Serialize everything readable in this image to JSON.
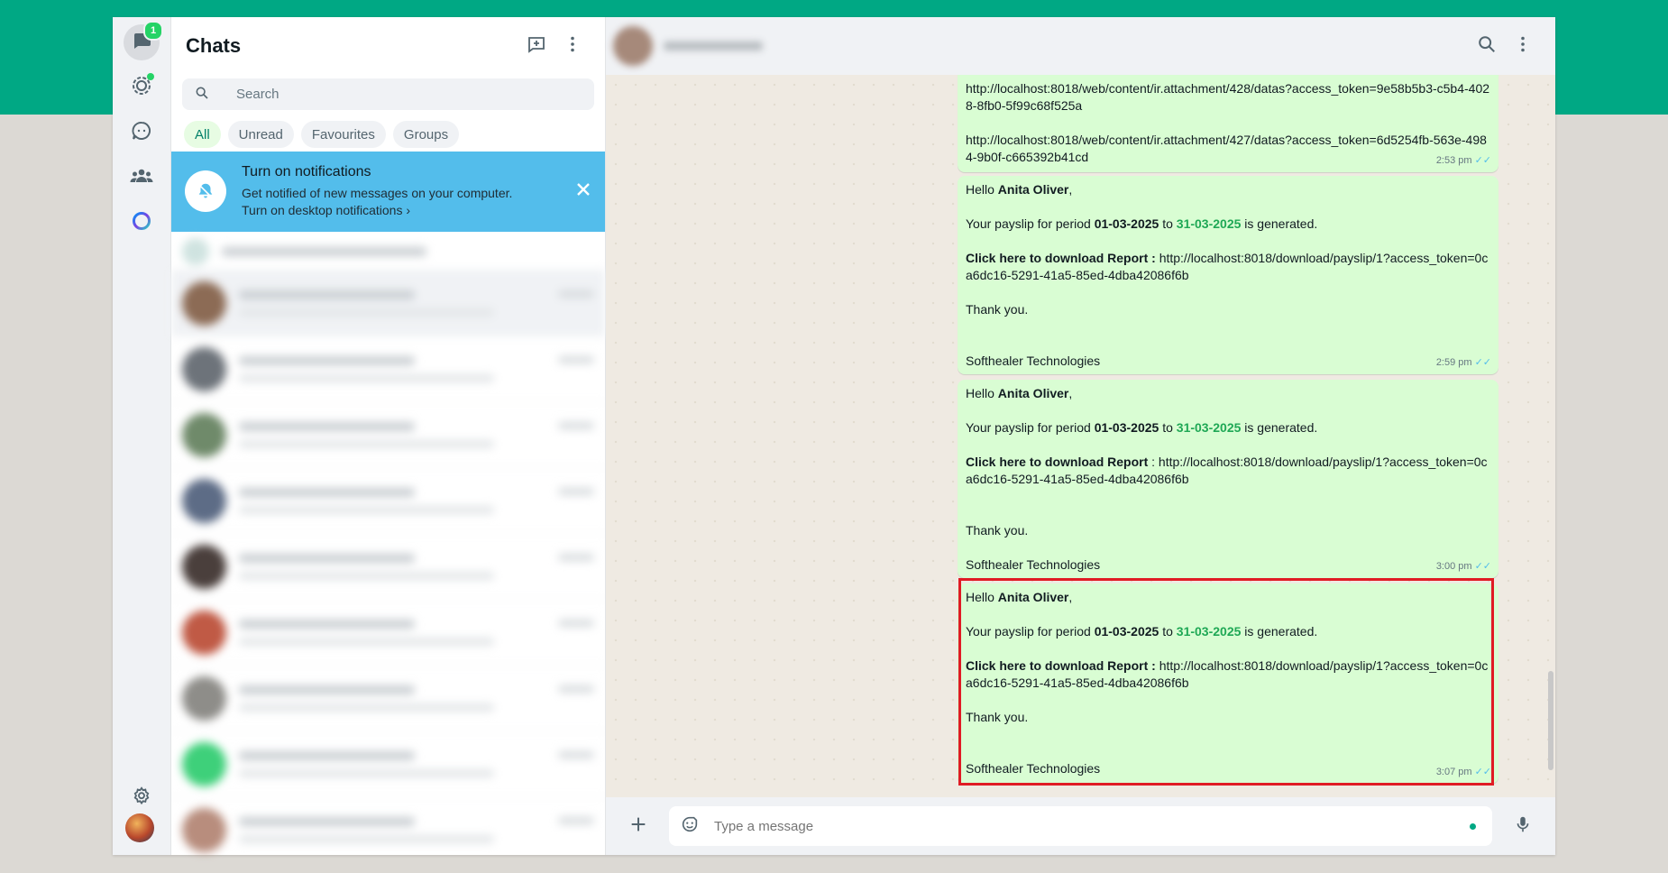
{
  "rail": {
    "chats_badge": "1",
    "icons": [
      "chats-icon",
      "status-icon",
      "channels-icon",
      "communities-icon",
      "meta-ai-icon",
      "settings-icon"
    ]
  },
  "sidebar": {
    "title": "Chats",
    "search_placeholder": "Search",
    "filters": [
      "All",
      "Unread",
      "Favourites",
      "Groups"
    ],
    "notification": {
      "title": "Turn on notifications",
      "subtitle": "Get notified of new messages on your computer.",
      "link": "Turn on desktop notifications"
    }
  },
  "conversation": {
    "messages": [
      {
        "link1": "http://localhost:8018/web/content/ir.attachment/428/datas?access_token=9e58b5b3-c5b4-4028-8fb0-5f99c68f525a",
        "link2": "http://localhost:8018/web/content/ir.attachment/427/datas?access_token=6d5254fb-563e-4984-9b0f-c665392b41cd",
        "time": "2:53 pm"
      },
      {
        "hello": "Hello ",
        "name": "Anita Oliver",
        "comma": ",",
        "payslip_pre": "Your payslip for period ",
        "from": "01-03-2025",
        "to_word": " to ",
        "to": "31-03-2025",
        "payslip_post": " is generated.",
        "download_label": "Click here to download Report : ",
        "download_link": "http://localhost:8018/download/payslip/1?access_token=0ca6dc16-5291-41a5-85ed-4dba42086f6b",
        "thanks": "Thank you.",
        "sign": "Softhealer Technologies",
        "time": "2:59 pm"
      },
      {
        "hello": "Hello ",
        "name": "Anita Oliver",
        "comma": ",",
        "payslip_pre": "Your payslip for period ",
        "from": "01-03-2025",
        "to_word": " to ",
        "to": "31-03-2025",
        "payslip_post": " is generated.",
        "download_label": "Click here to download Report",
        "download_sep": " : ",
        "download_link": "http://localhost:8018/download/payslip/1?access_token=0ca6dc16-5291-41a5-85ed-4dba42086f6b",
        "thanks": "Thank you.",
        "sign": "Softhealer Technologies",
        "time": "3:00 pm"
      },
      {
        "hello": "Hello ",
        "name": "Anita Oliver",
        "comma": ",",
        "payslip_pre": "Your payslip for period ",
        "from": "01-03-2025",
        "to_word": " to ",
        "to": "31-03-2025",
        "payslip_post": " is generated.",
        "download_label": "Click here to download Report : ",
        "download_link": "http://localhost:8018/download/payslip/1?access_token=0ca6dc16-5291-41a5-85ed-4dba42086f6b",
        "thanks": "Thank you.",
        "sign": "Softhealer Technologies",
        "time": "3:07 pm"
      }
    ],
    "composer_placeholder": "Type a message"
  },
  "colors": {
    "brand": "#00a884",
    "bubble_out": "#d9fdd3",
    "date_green": "#1fa855",
    "notif_blue": "#53bdeb",
    "highlight_red": "#e01b24"
  }
}
